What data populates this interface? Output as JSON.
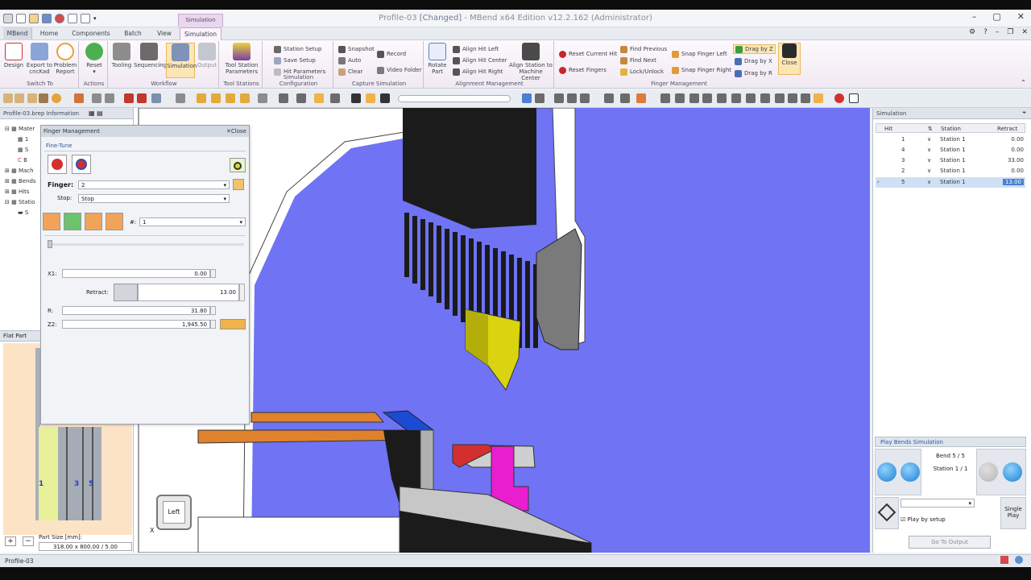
{
  "window": {
    "title_prefix": "Profile-03 ",
    "title_changed": "[Changed]",
    "title_suffix": " - MBend x64 Edition v12.2.162 (Administrator)",
    "contextual_tab": "Simulation"
  },
  "tabs": [
    "MBend",
    "Home",
    "Components",
    "Batch",
    "View",
    "Simulation"
  ],
  "ribbon": {
    "switch_to": {
      "label": "Switch To",
      "design": "Design",
      "export": "Export to cncKad",
      "problem": "Problem Report"
    },
    "actions": {
      "label": "Actions",
      "reset": "Reset"
    },
    "workflow": {
      "label": "Workflow",
      "tooling": "Tooling",
      "sequencing": "Sequencing",
      "simulation": "Simulation",
      "output": "Output"
    },
    "tool_stations": {
      "label": "Tool Stations",
      "params": "Tool Station Parameters"
    },
    "sim_config": {
      "label": "Simulation Configuration",
      "station_setup": "Station Setup",
      "save_setup": "Save Setup",
      "hit_params": "Hit Parameters"
    },
    "capture": {
      "label": "Capture Simulation",
      "snapshot": "Snapshot",
      "auto": "Auto",
      "clear": "Clear",
      "record": "Record",
      "video_folder": "Video Folder"
    },
    "align": {
      "label": "Alignment Management",
      "rotate": "Rotate Part",
      "left": "Align Hit Left",
      "center": "Align Hit Center",
      "right": "Align Hit Right",
      "machine_center": "Align Station to Machine Center"
    },
    "finger": {
      "label": "Finger Management",
      "reset_hit": "Reset Current Hit",
      "reset_fingers": "Reset Fingers",
      "find_prev": "Find Previous",
      "find_next": "Find Next",
      "lock": "Lock/Unlock",
      "snap_left": "Snap Finger Left",
      "snap_right": "Snap Finger Right",
      "drag_z": "Drag by Z",
      "drag_x": "Drag by X",
      "drag_r": "Drag by R",
      "close": "Close"
    }
  },
  "left_panel": {
    "title": "Profile-03.brep Information",
    "tree": [
      "Mater",
      "1",
      "S",
      "B",
      "Mach",
      "Bends",
      "Hits",
      "Statio",
      "S"
    ],
    "flat_part": "Flat Part",
    "bend_labels": [
      "1",
      "3",
      "5"
    ],
    "part_size_label": "Part Size [mm]:",
    "part_size_value": "318.00 x 800.00 / 5.00"
  },
  "finger_mgmt": {
    "title": "Finger Management",
    "close": "Close",
    "fine_tune": "Fine-Tune",
    "finger_label": "Finger:",
    "finger_value": "2",
    "stop_label": "Stop:",
    "stop_value": "Stop",
    "hash_label": "#:",
    "hash_value": "1",
    "x1_label": "X1:",
    "x1_value": "0.00",
    "retract_label": "Retract:",
    "retract_value": "13.00",
    "r_label": "R:",
    "r_value": "31.80",
    "z2_label": "Z2:",
    "z2_value": "1,945.50"
  },
  "viewcube": {
    "face": "Left",
    "axis_x": "X"
  },
  "simulation": {
    "title": "Simulation",
    "headers": [
      "Hit",
      "Station",
      "Retract"
    ],
    "rows": [
      {
        "hit": "1",
        "station": "Station 1",
        "retract": "0.00"
      },
      {
        "hit": "4",
        "station": "Station 1",
        "retract": "0.00"
      },
      {
        "hit": "3",
        "station": "Station 1",
        "retract": "33.00"
      },
      {
        "hit": "2",
        "station": "Station 1",
        "retract": "0.00"
      },
      {
        "hit": "5",
        "station": "Station 1",
        "retract": "13.00"
      }
    ],
    "play_title": "Play Bends Simulation",
    "bend_status": "Bend 5 / 5",
    "station_status": "Station 1 / 1",
    "single_play": "Single Play",
    "play_by_setup": "Play by setup",
    "go_to_output": "Go To Output"
  },
  "status": {
    "text": "Profile-03"
  },
  "colors": {
    "viewport": "#6f73f4",
    "ribbon_active": "#fce6b4",
    "selection": "#cfe0f5"
  }
}
